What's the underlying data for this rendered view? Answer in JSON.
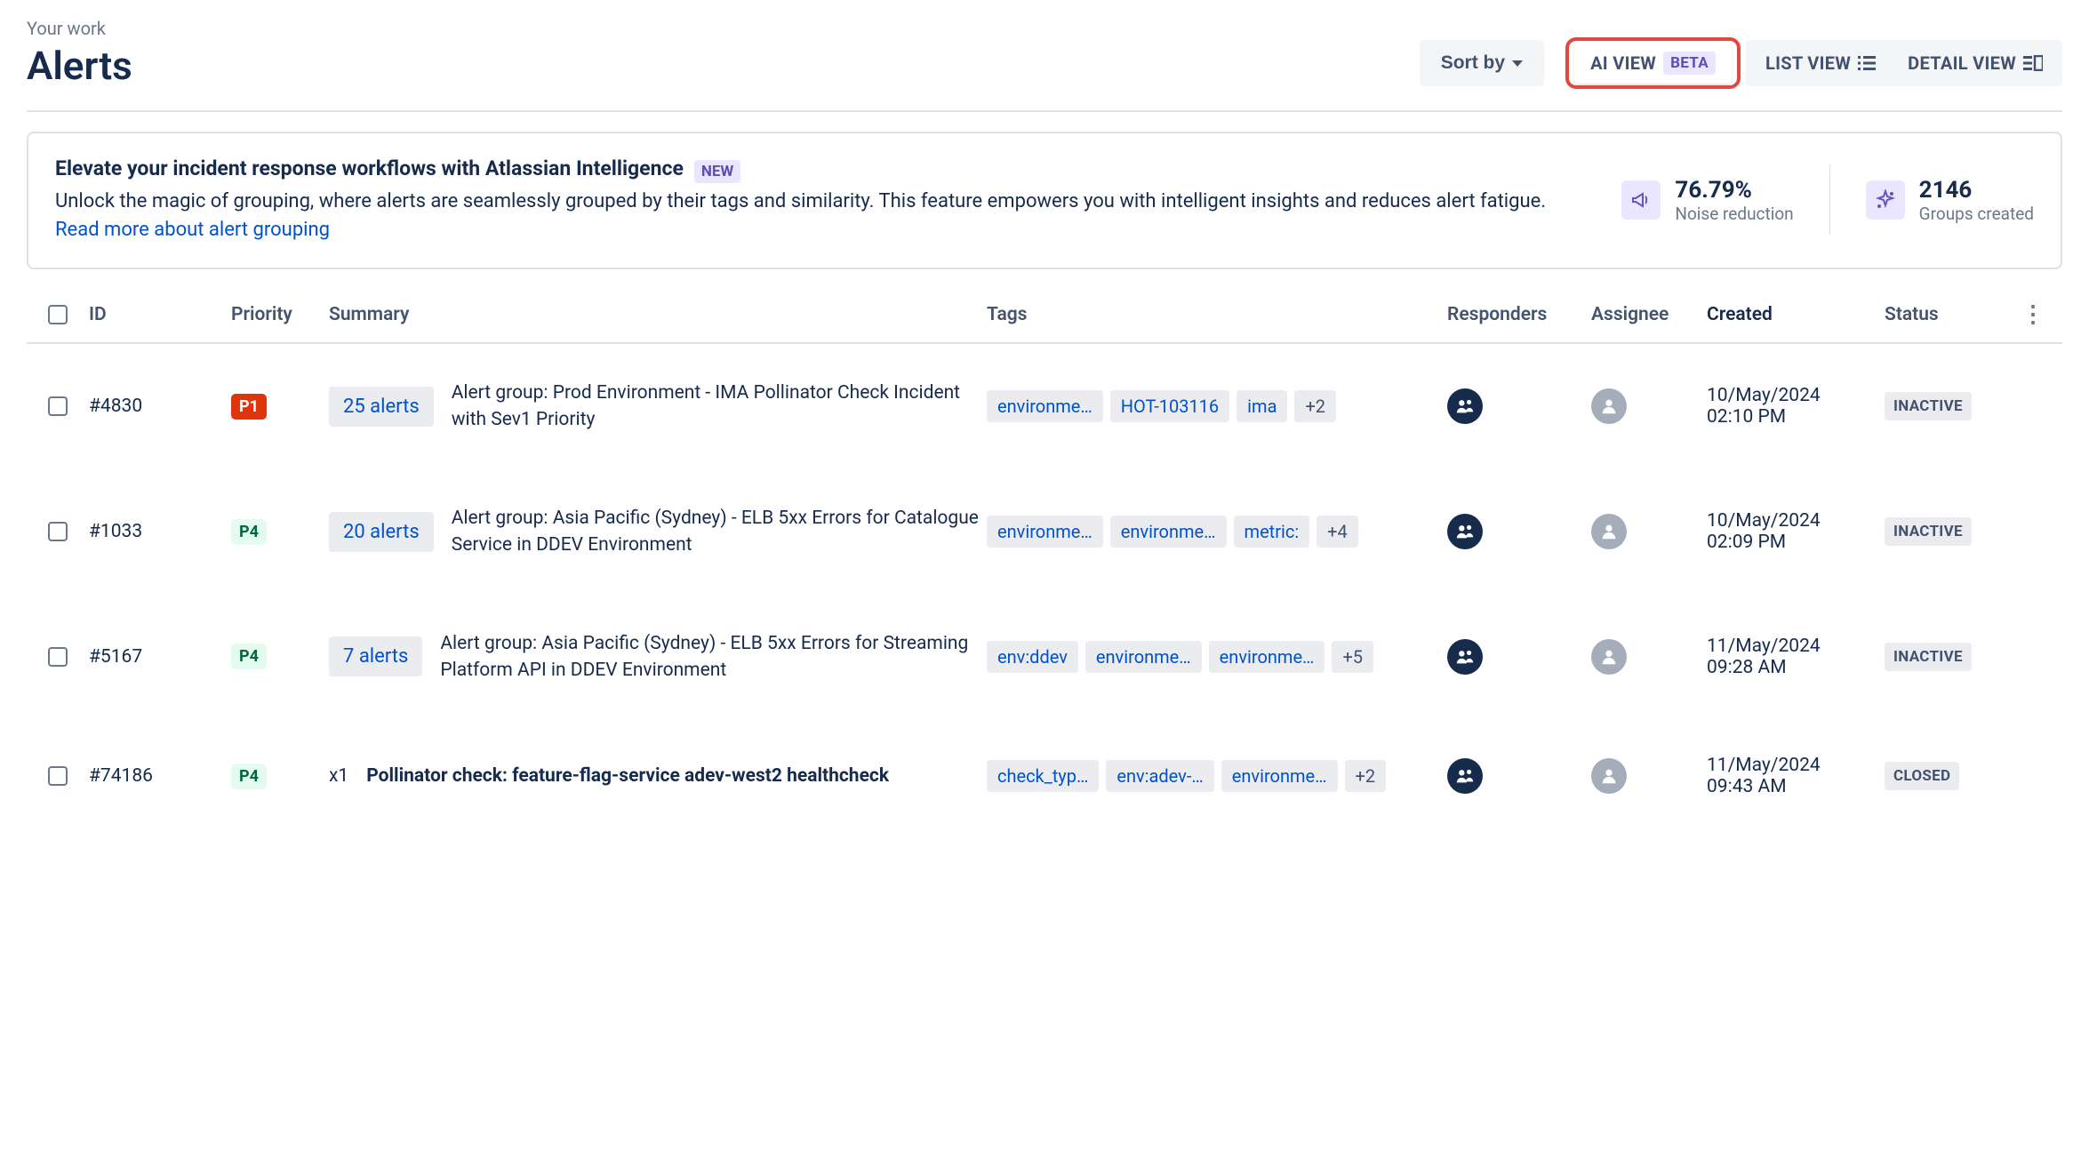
{
  "breadcrumb": "Your work",
  "page_title": "Alerts",
  "sort_label": "Sort by",
  "views": {
    "ai": "AI VIEW",
    "ai_badge": "BETA",
    "list": "LIST VIEW",
    "detail": "DETAIL VIEW"
  },
  "banner": {
    "title": "Elevate your incident response workflows with Atlassian Intelligence",
    "new_badge": "NEW",
    "desc_prefix": "Unlock the magic of grouping, where alerts are seamlessly grouped by their tags and similarity. This feature empowers you with intelligent insights and reduces alert fatigue. ",
    "link": "Read more about alert grouping",
    "stats": {
      "noise_val": "76.79%",
      "noise_label": "Noise reduction",
      "groups_val": "2146",
      "groups_label": "Groups created"
    }
  },
  "columns": {
    "id": "ID",
    "priority": "Priority",
    "summary": "Summary",
    "tags": "Tags",
    "responders": "Responders",
    "assignee": "Assignee",
    "created": "Created",
    "status": "Status"
  },
  "rows": [
    {
      "id": "#4830",
      "priority": "P1",
      "priority_class": "p1",
      "alerts_count": "25 alerts",
      "summary": "Alert group: Prod Environment - IMA Pollinator Check Incident with Sev1 Priority",
      "summary_bold": false,
      "tags": [
        "environme…",
        "HOT-103116",
        "ima"
      ],
      "tag_more": "+2",
      "created_date": "10/May/2024",
      "created_time": "02:10 PM",
      "status": "INACTIVE"
    },
    {
      "id": "#1033",
      "priority": "P4",
      "priority_class": "p4",
      "alerts_count": "20 alerts",
      "summary": "Alert group: Asia Pacific (Sydney) - ELB 5xx Errors for Catalogue Service in DDEV Environment",
      "summary_bold": false,
      "tags": [
        "environme…",
        "environme…",
        "metric:"
      ],
      "tag_more": "+4",
      "created_date": "10/May/2024",
      "created_time": "02:09 PM",
      "status": "INACTIVE"
    },
    {
      "id": "#5167",
      "priority": "P4",
      "priority_class": "p4",
      "alerts_count": "7 alerts",
      "summary": "Alert group: Asia Pacific (Sydney) - ELB 5xx Errors for Streaming Platform API in DDEV Environment",
      "summary_bold": false,
      "tags": [
        "env:ddev",
        "environme…",
        "environme…"
      ],
      "tag_more": "+5",
      "created_date": "11/May/2024",
      "created_time": "09:28 AM",
      "status": "INACTIVE"
    },
    {
      "id": "#74186",
      "priority": "P4",
      "priority_class": "p4",
      "mult": "x1",
      "summary": "Pollinator check: feature-flag-service adev-west2 healthcheck",
      "summary_bold": true,
      "tags": [
        "check_typ…",
        "env:adev-…",
        "environme…"
      ],
      "tag_more": "+2",
      "created_date": "11/May/2024",
      "created_time": "09:43 AM",
      "status": "CLOSED"
    }
  ]
}
